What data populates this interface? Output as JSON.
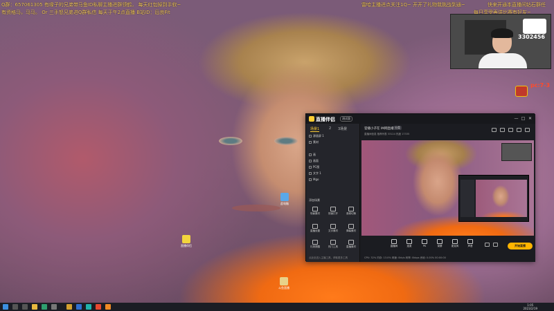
{
  "stream_overlay": {
    "line1_left": "Q群：657061305 有缘子的兄弟带马鱼ID私聊主播进群领鹤， 每天红包掉到手软~",
    "line2_left": "有资格马，马马。 Or 三手怒兄弟进Q群私信     每天于午2点直播    B站ID：后良Fit",
    "line1_right": "雷哈主播进点关注1Q~ 开开了礼物我挑战到通~",
    "line1_far_right": "快来开通本直播间钻石群任",
    "line2_far_right": "每日享受再讲比赛有好友~"
  },
  "webcam": {
    "count": "3302456"
  },
  "side_label": "pc:7-3",
  "desktop_icons": [
    {
      "label": "此电脑"
    },
    {
      "label": "直播伴侣"
    },
    {
      "label": "斗鱼直播"
    }
  ],
  "app": {
    "title": "直播伴侣",
    "version": "测试版",
    "window_controls": [
      "—",
      "□",
      "✕"
    ],
    "left_tabs": [
      "场景1",
      "2",
      "3场景"
    ],
    "scenes": [
      "源画屏 1",
      "素材",
      "画",
      "画面",
      "PC图",
      "文字 1",
      "Mgo"
    ],
    "add_scene": "添加场景",
    "tools": [
      "场景素材",
      "快速打开",
      "音频切换",
      "直播设置",
      "文字素材",
      "弹幕素材",
      "礼物提醒",
      "热门工具",
      "直播素材",
      "直播伴侣",
      "一键开播",
      "主播中心"
    ],
    "left_footer": "点此处进入主播工具，获取更多工具",
    "main_title": "官播小子在 IM网直播",
    "main_tag": "分类",
    "main_stats": "直播间信息    推荐列表   33124   热度   17335",
    "controls": [
      "直播间",
      "连麦",
      "PK",
      "录屏",
      "麦克风",
      "声音"
    ],
    "live_button": "开始直播",
    "status": "CPU: 32%    内存: 13.0%    网速: 0kb/s         码率: 0kbps    丢帧: 0.00%     00:00:00"
  },
  "taskbar": {
    "time": "1:05",
    "date": "2023/2/19"
  },
  "colors": {
    "accent": "#ffce34",
    "overlay_text": "#f4c85d",
    "live_button": "#ffb400"
  }
}
